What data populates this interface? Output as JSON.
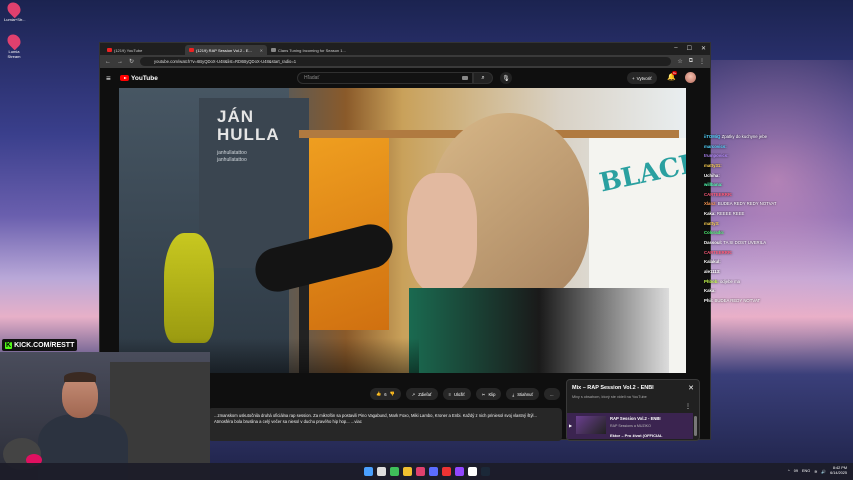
{
  "desktop": {
    "icons": [
      {
        "label": "Lumia+Str..."
      },
      {
        "label": "Lumia Stream"
      }
    ]
  },
  "browser": {
    "tabs": [
      {
        "label": "(1219) YouTube",
        "active": false
      },
      {
        "label": "(1219) RAP Session Vol.2 - E...",
        "active": true
      },
      {
        "label": "Clans Tuning Incoming for Season 1...",
        "active": false
      }
    ],
    "url": "youtube.com/watch?v=6ByQDoX-U48&list=RD6ByQDoX-U48&start_radio=1"
  },
  "youtube": {
    "logo": "YouTube",
    "search_placeholder": "Hľadať",
    "create_label": "Vytvoriť",
    "notif_count": "9+",
    "actions": {
      "likes": "6",
      "share": "Zdieľať",
      "save": "Uložiť",
      "clip": "Klip",
      "download": "Stiahnuť",
      "more": "..."
    },
    "description": "...zmanskom uskutočnila druhá oficiálna rap session. Za mikrofón sa postavili Pino Vagabund, Mark Foxo, Miki Lambo, Kroner a Enbi. Každý z nich priniesol svoj vlastný štýl... Atmosféra bola bruslina a celý večer sa niesol v duchu pravého hip hop... ...viac",
    "video_overlay": {
      "banner_title": "JÁN\nHULLA",
      "banner_handles": "janhullatattoo\njanhullatattoo",
      "graffiti": "BLACK"
    },
    "mix": {
      "title": "Mix – RAP Session Vol.2 - ENBI",
      "subtitle": "Mixy s obsahom, ktorý ste videli na YouTube",
      "item_title": "RAP Session Vol.2 - ENBI",
      "item_channel": "RAP Sessions a MUZIKO",
      "next_item": "Ektor – Pro život (OFFICIAL"
    }
  },
  "chat": {
    "lines": [
      {
        "user": "iiTOMiQ",
        "text": "Zpatky do kuchyne jebe",
        "color": "#52d6ff"
      },
      {
        "user": "marcovics:",
        "text": "",
        "color": "#52d6ff"
      },
      {
        "user": "trumpovics:",
        "text": "",
        "color": "#b58aff"
      },
      {
        "user": "matty31:",
        "text": "",
        "color": "#ffd352"
      },
      {
        "user": "Uchiha:",
        "text": "",
        "color": "#ffffff"
      },
      {
        "user": "willbana:",
        "text": "",
        "color": "#52ffb2"
      },
      {
        "user": "CARTEERRR:",
        "text": "",
        "color": "#ff5a7a"
      },
      {
        "user": "Xlanz:",
        "text": "BUDEA REDY REDY NOTVAT",
        "color": "#ff9b52"
      },
      {
        "user": "Kaka:",
        "text": "REEEE REEE",
        "color": "#ffffff"
      },
      {
        "user": "matty3:",
        "text": "",
        "color": "#ffd352"
      },
      {
        "user": "Colorado:",
        "text": "",
        "color": "#52ff7a"
      },
      {
        "user": "Dassoul:",
        "text": "TA SI DOST UVERILA",
        "color": "#ffffff"
      },
      {
        "user": "CARTEERRR:",
        "text": "",
        "color": "#ff5a7a"
      },
      {
        "user": "Kalakul:",
        "text": "",
        "color": "#ffffff"
      },
      {
        "user": "ale1113:",
        "text": "",
        "color": "#ffffff"
      },
      {
        "user": "Phbob:",
        "text": "odjebe ma",
        "color": "#c9ff52"
      },
      {
        "user": "Kaka:",
        "text": "",
        "color": "#ffffff"
      },
      {
        "user": "Phil:",
        "text": "BUDEA REDY NOTVAT",
        "color": "#ffffff"
      }
    ]
  },
  "stream": {
    "kick_prefix": "K",
    "kick_handle": "KICK.COM/RESTT"
  },
  "taskbar": {
    "lang": "ENG",
    "time": "8:42 PM",
    "date": "6/14/2025",
    "tray_temp": "09"
  },
  "colors": {
    "yt_red": "#ff0000",
    "kick_green": "#53fc18",
    "chat_panel": "#212121"
  }
}
